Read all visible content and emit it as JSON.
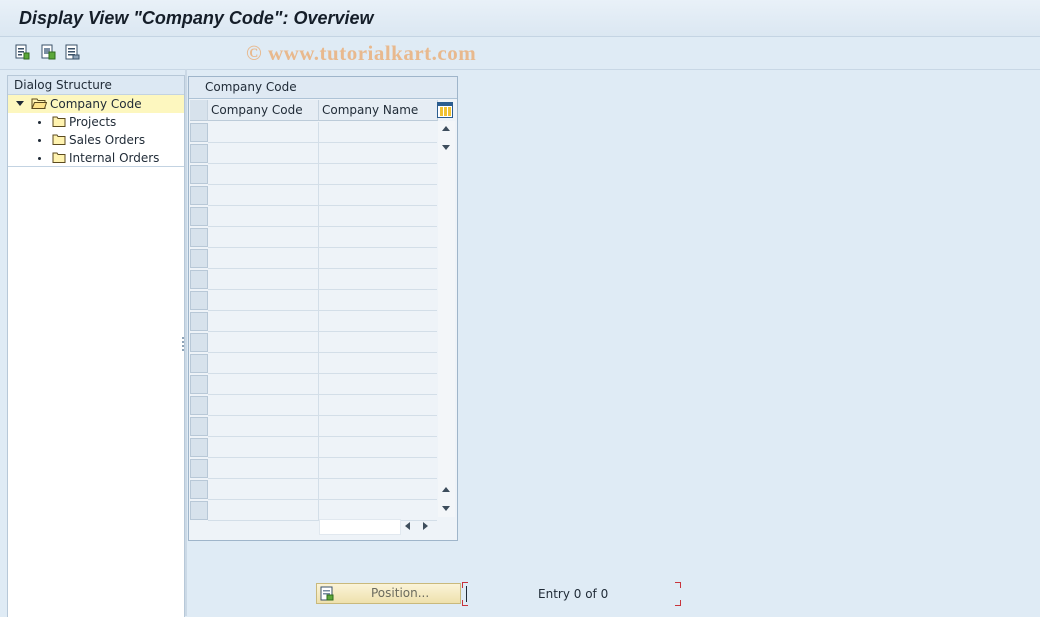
{
  "window": {
    "title": "Display View \"Company Code\": Overview"
  },
  "toolbar": {
    "buttons": [
      {
        "icon": "display-details-icon"
      },
      {
        "icon": "select-all-icon"
      },
      {
        "icon": "print-list-icon"
      }
    ],
    "watermark": "© www.tutorialkart.com"
  },
  "dialog_structure": {
    "header": "Dialog Structure",
    "items": [
      {
        "label": "Company Code",
        "level": 0,
        "expanded": true,
        "selected": true,
        "icon": "open-folder-icon"
      },
      {
        "label": "Projects",
        "level": 1,
        "icon": "folder-icon"
      },
      {
        "label": "Sales Orders",
        "level": 1,
        "icon": "folder-icon"
      },
      {
        "label": "Internal Orders",
        "level": 1,
        "icon": "folder-icon"
      }
    ]
  },
  "table": {
    "title": "Company Code",
    "columns": [
      "Company Code",
      "Company Name"
    ],
    "rows": []
  },
  "footer": {
    "position_button": "Position...",
    "entry_text": "Entry 0 of 0"
  },
  "colors": {
    "background": "#dfebf5",
    "selected_row": "#fdf7bf",
    "focus_bracket": "#c8343c"
  }
}
